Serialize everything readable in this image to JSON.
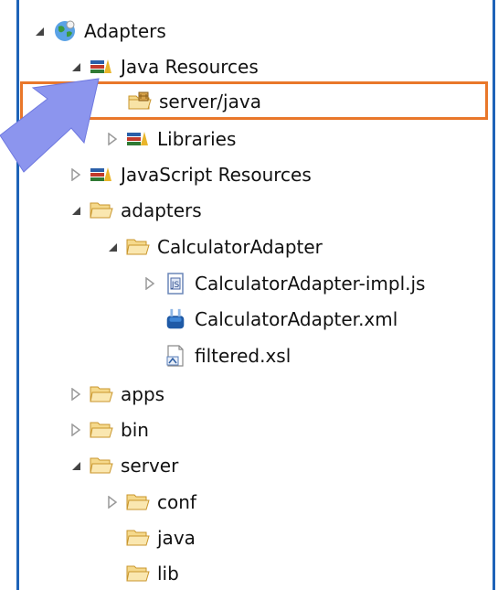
{
  "tree": {
    "nodes": [
      {
        "label": "Adapters",
        "expanded": true,
        "icon": "globe-project-icon"
      },
      {
        "label": "Java Resources",
        "expanded": true,
        "icon": "java-resources-icon"
      },
      {
        "label": "server/java",
        "icon": "source-folder-icon",
        "selected_highlight": true
      },
      {
        "label": "Libraries",
        "expanded": false,
        "icon": "library-icon"
      },
      {
        "label": "JavaScript Resources",
        "expanded": false,
        "icon": "javascript-resources-icon"
      },
      {
        "label": "adapters",
        "expanded": true,
        "icon": "folder-icon"
      },
      {
        "label": "CalculatorAdapter",
        "expanded": true,
        "icon": "folder-icon"
      },
      {
        "label": "CalculatorAdapter-impl.js",
        "expanded": false,
        "icon": "js-file-icon"
      },
      {
        "label": "CalculatorAdapter.xml",
        "icon": "adapter-xml-icon"
      },
      {
        "label": "filtered.xsl",
        "icon": "xsl-file-icon"
      },
      {
        "label": "apps",
        "expanded": false,
        "icon": "folder-icon"
      },
      {
        "label": "bin",
        "expanded": false,
        "icon": "folder-icon"
      },
      {
        "label": "server",
        "expanded": true,
        "icon": "folder-icon"
      },
      {
        "label": "conf",
        "expanded": false,
        "icon": "folder-icon"
      },
      {
        "label": "java",
        "icon": "folder-icon"
      },
      {
        "label": "lib",
        "icon": "folder-icon"
      }
    ]
  },
  "colors": {
    "panel_border": "#1e63b8",
    "highlight_border": "#e9772a",
    "arrow": "#8c95ee",
    "folder": "#f2c76b"
  }
}
